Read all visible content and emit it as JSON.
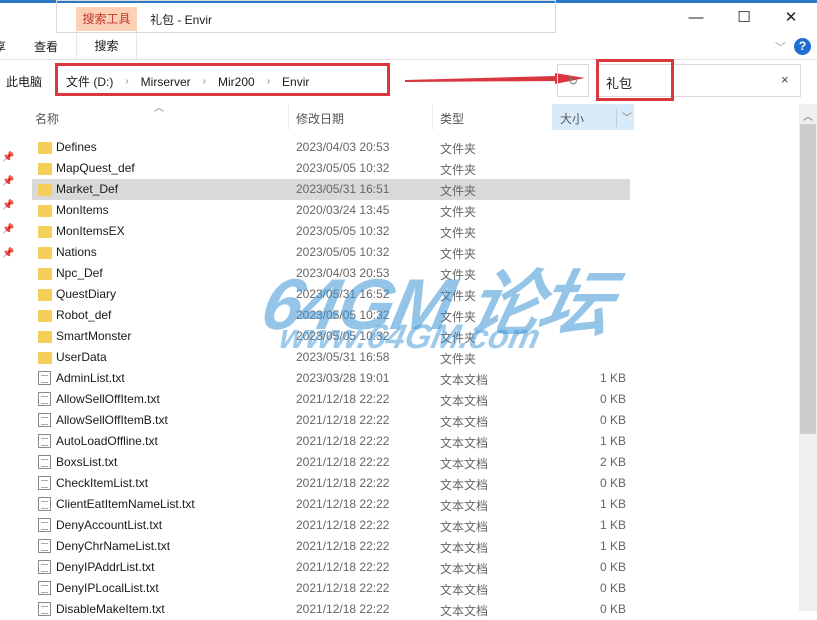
{
  "window": {
    "title": "礼包 - Envir",
    "minimize": "—",
    "maximize": "☐",
    "close": "✕"
  },
  "ribbon": {
    "context_tab": "搜索工具",
    "tabs": [
      "享",
      "查看",
      "搜索"
    ],
    "help": "?"
  },
  "address": {
    "root": "此电脑",
    "crumbs": [
      "文件 (D:)",
      "Mirserver",
      "Mir200",
      "Envir"
    ]
  },
  "search": {
    "value": "礼包",
    "clear": "×"
  },
  "columns": {
    "name": "名称",
    "date": "修改日期",
    "type": "类型",
    "size": "大小"
  },
  "accent": "#d9363e",
  "watermark": {
    "main": "64GM 论坛",
    "url": "www.64GM.com"
  },
  "files": [
    {
      "name": "Defines",
      "date": "2023/04/03 20:53",
      "type": "文件夹",
      "size": "",
      "kind": "folder"
    },
    {
      "name": "MapQuest_def",
      "date": "2023/05/05 10:32",
      "type": "文件夹",
      "size": "",
      "kind": "folder"
    },
    {
      "name": "Market_Def",
      "date": "2023/05/31 16:51",
      "type": "文件夹",
      "size": "",
      "kind": "folder",
      "selected": true
    },
    {
      "name": "MonItems",
      "date": "2020/03/24 13:45",
      "type": "文件夹",
      "size": "",
      "kind": "folder"
    },
    {
      "name": "MonItemsEX",
      "date": "2023/05/05 10:32",
      "type": "文件夹",
      "size": "",
      "kind": "folder"
    },
    {
      "name": "Nations",
      "date": "2023/05/05 10:32",
      "type": "文件夹",
      "size": "",
      "kind": "folder"
    },
    {
      "name": "Npc_Def",
      "date": "2023/04/03 20:53",
      "type": "文件夹",
      "size": "",
      "kind": "folder"
    },
    {
      "name": "QuestDiary",
      "date": "2023/05/31 16:52",
      "type": "文件夹",
      "size": "",
      "kind": "folder"
    },
    {
      "name": "Robot_def",
      "date": "2023/05/05 10:32",
      "type": "文件夹",
      "size": "",
      "kind": "folder"
    },
    {
      "name": "SmartMonster",
      "date": "2023/05/05 10:32",
      "type": "文件夹",
      "size": "",
      "kind": "folder"
    },
    {
      "name": "UserData",
      "date": "2023/05/31 16:58",
      "type": "文件夹",
      "size": "",
      "kind": "folder"
    },
    {
      "name": "AdminList.txt",
      "date": "2023/03/28 19:01",
      "type": "文本文档",
      "size": "1 KB",
      "kind": "file"
    },
    {
      "name": "AllowSellOffItem.txt",
      "date": "2021/12/18 22:22",
      "type": "文本文档",
      "size": "0 KB",
      "kind": "file"
    },
    {
      "name": "AllowSellOffItemB.txt",
      "date": "2021/12/18 22:22",
      "type": "文本文档",
      "size": "0 KB",
      "kind": "file"
    },
    {
      "name": "AutoLoadOffline.txt",
      "date": "2021/12/18 22:22",
      "type": "文本文档",
      "size": "1 KB",
      "kind": "file"
    },
    {
      "name": "BoxsList.txt",
      "date": "2021/12/18 22:22",
      "type": "文本文档",
      "size": "2 KB",
      "kind": "file"
    },
    {
      "name": "CheckItemList.txt",
      "date": "2021/12/18 22:22",
      "type": "文本文档",
      "size": "0 KB",
      "kind": "file"
    },
    {
      "name": "ClientEatItemNameList.txt",
      "date": "2021/12/18 22:22",
      "type": "文本文档",
      "size": "1 KB",
      "kind": "file"
    },
    {
      "name": "DenyAccountList.txt",
      "date": "2021/12/18 22:22",
      "type": "文本文档",
      "size": "1 KB",
      "kind": "file"
    },
    {
      "name": "DenyChrNameList.txt",
      "date": "2021/12/18 22:22",
      "type": "文本文档",
      "size": "1 KB",
      "kind": "file"
    },
    {
      "name": "DenyIPAddrList.txt",
      "date": "2021/12/18 22:22",
      "type": "文本文档",
      "size": "0 KB",
      "kind": "file"
    },
    {
      "name": "DenyIPLocalList.txt",
      "date": "2021/12/18 22:22",
      "type": "文本文档",
      "size": "0 KB",
      "kind": "file"
    },
    {
      "name": "DisableMakeItem.txt",
      "date": "2021/12/18 22:22",
      "type": "文本文档",
      "size": "0 KB",
      "kind": "file"
    }
  ]
}
